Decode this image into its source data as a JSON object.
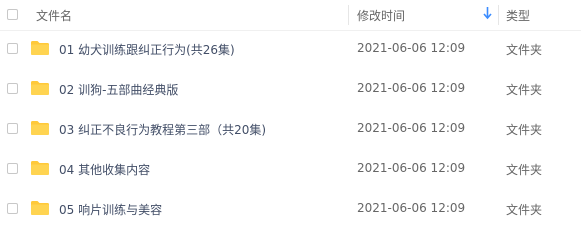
{
  "header": {
    "name_label": "文件名",
    "time_label": "修改时间",
    "type_label": "类型"
  },
  "rows": [
    {
      "name": "01 幼犬训练跟纠正行为(共26集)",
      "modified": "2021-06-06 12:09",
      "type": "文件夹"
    },
    {
      "name": "02 训狗-五部曲经典版",
      "modified": "2021-06-06 12:09",
      "type": "文件夹"
    },
    {
      "name": "03 纠正不良行为教程第三部（共20集)",
      "modified": "2021-06-06 12:09",
      "type": "文件夹"
    },
    {
      "name": "04 其他收集内容",
      "modified": "2021-06-06 12:09",
      "type": "文件夹"
    },
    {
      "name": "05 响片训练与美容",
      "modified": "2021-06-06 12:09",
      "type": "文件夹"
    }
  ],
  "colors": {
    "folder": "#ffc93a",
    "sort_arrow": "#3b8cff",
    "name_text": "#424e67"
  },
  "icons": {
    "folder": "folder-icon",
    "sort": "sort-descending-icon"
  }
}
